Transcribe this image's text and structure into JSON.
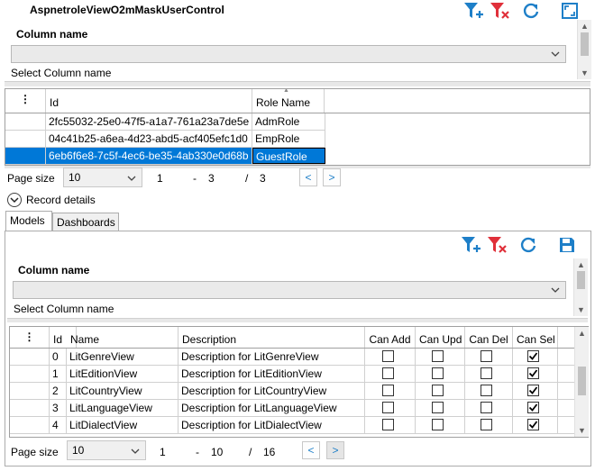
{
  "window": {
    "title": "AspnetroleViewO2mMaskUserControl"
  },
  "top_panel": {
    "column_label": "Column name",
    "select_hint": "Select Column name",
    "toolbar": [
      "add-filter-icon",
      "remove-filter-icon",
      "refresh-icon",
      "maximize-icon"
    ]
  },
  "roles_grid": {
    "headers": [
      "⋮",
      "Id",
      "Role Name"
    ],
    "rows": [
      {
        "id": "2fc55032-25e0-47f5-a1a7-761a23a7de5e",
        "name": "AdmRole"
      },
      {
        "id": "04c41b25-a6ea-4d23-abd5-acf405efc1d0",
        "name": "EmpRole"
      },
      {
        "id": "6eb6f6e8-7c5f-4ec6-be35-4ab330e0d68b",
        "name": "GuestRole"
      }
    ],
    "selected_row": 2
  },
  "pager1": {
    "label": "Page size",
    "size": "10",
    "first": "1",
    "dash": "-",
    "last": "3",
    "slash": "/",
    "total": "3",
    "prev": "<",
    "next": ">"
  },
  "record_details": {
    "label": "Record details",
    "icon": "chevron-down-icon"
  },
  "tabs": [
    {
      "label": "Models"
    },
    {
      "label": "Dashboards"
    }
  ],
  "models_panel": {
    "column_label": "Column name",
    "select_hint": "Select Column name",
    "toolbar": [
      "add-filter-icon",
      "remove-filter-icon",
      "refresh-icon",
      "save-icon"
    ]
  },
  "models_grid": {
    "headers": [
      "⋮",
      "Id",
      "Name",
      "Description",
      "Can Add",
      "Can Upd",
      "Can Del",
      "Can Sel"
    ],
    "rows": [
      {
        "id": "0",
        "name": "LitGenreView",
        "desc": "Description for LitGenreView",
        "add": false,
        "upd": false,
        "del": false,
        "sel": true
      },
      {
        "id": "1",
        "name": "LitEditionView",
        "desc": "Description for LitEditionView",
        "add": false,
        "upd": false,
        "del": false,
        "sel": true
      },
      {
        "id": "2",
        "name": "LitCountryView",
        "desc": "Description for LitCountryView",
        "add": false,
        "upd": false,
        "del": false,
        "sel": true
      },
      {
        "id": "3",
        "name": "LitLanguageView",
        "desc": "Description for LitLanguageView",
        "add": false,
        "upd": false,
        "del": false,
        "sel": true
      },
      {
        "id": "4",
        "name": "LitDialectView",
        "desc": "Description for LitDialectView",
        "add": false,
        "upd": false,
        "del": false,
        "sel": true
      }
    ]
  },
  "pager2": {
    "label": "Page size",
    "size": "10",
    "first": "1",
    "dash": "-",
    "last": "10",
    "slash": "/",
    "total": "16",
    "prev": "<",
    "next": ">"
  },
  "colors": {
    "accent": "#0078d7",
    "filter_blue": "#1e7fc8",
    "filter_red": "#e0303a"
  }
}
